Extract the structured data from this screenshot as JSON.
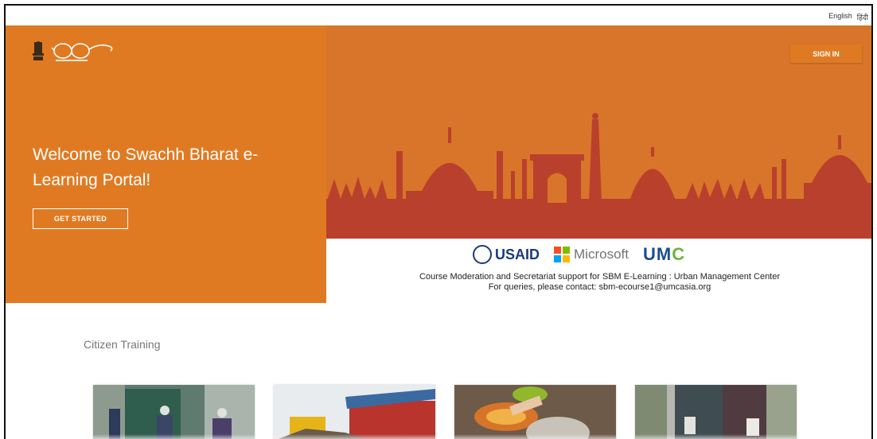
{
  "topbar": {
    "lang_en": "English",
    "lang_hi": "हिंदी"
  },
  "hero": {
    "welcome_line1": "Welcome to Swachh Bharat e-",
    "welcome_line2": "Learning Portal!",
    "get_started_label": "GET STARTED",
    "signin_label": "SIGN IN",
    "brand_color": "#e07a22"
  },
  "sponsors": {
    "usaid": "USAID",
    "microsoft": "Microsoft",
    "umc": "UMC",
    "credit_line": "Course Moderation and Secretariat support for SBM E-Learning : Urban Management Center",
    "contact_line": "For queries, please contact: sbm-ecourse1@umcasia.org"
  },
  "section": {
    "title": "Citizen Training"
  },
  "icons": [
    "national-emblem-icon",
    "swachh-bharat-glasses-icon",
    "usaid-seal-icon",
    "microsoft-logo-icon"
  ]
}
